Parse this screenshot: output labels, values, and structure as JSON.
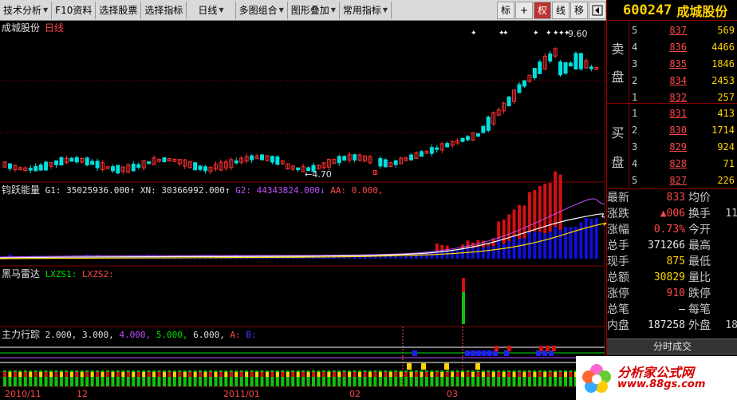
{
  "toolbar": {
    "items": [
      "技术分析",
      "F10资料",
      "选择股票",
      "选择指标",
      "日线",
      "多图组合",
      "图形叠加",
      "常用指标"
    ],
    "small_buttons": [
      "标",
      "+",
      "权",
      "线",
      "移"
    ],
    "active_small": 2
  },
  "chart": {
    "stock_name": "成城股份",
    "period": "日线",
    "high_label": "9.60",
    "low_label": "4.70",
    "x_axis_labels": [
      "2010/11",
      "12",
      "2011/01",
      "02",
      "03"
    ]
  },
  "indicators": {
    "energy": {
      "name": "钧跃能量",
      "g1": "G1: 35025936.000↑",
      "xn": "XN: 30366992.000↑",
      "g2": "G2: 44343824.000↓",
      "aa": "AA: 0.000,"
    },
    "radar": {
      "name": "黑马雷达",
      "lxzs1": "LXZS1:",
      "lxzs2": "LXZS2:"
    },
    "tracking": {
      "name": "主力行踪",
      "v1": "2.000,",
      "v2": "3.000,",
      "v3": "4.000,",
      "v4": "5.000,",
      "v5": "6.000,",
      "a": "A:",
      "b": "B:"
    }
  },
  "quote": {
    "code": "600247",
    "name": "成城股份",
    "sell_label": [
      "卖",
      "盘"
    ],
    "buy_label": [
      "买",
      "盘"
    ],
    "asks": [
      {
        "level": "5",
        "price": "837",
        "vol": "569"
      },
      {
        "level": "4",
        "price": "836",
        "vol": "4466"
      },
      {
        "level": "3",
        "price": "835",
        "vol": "1846"
      },
      {
        "level": "2",
        "price": "834",
        "vol": "2453"
      },
      {
        "level": "1",
        "price": "832",
        "vol": "257"
      }
    ],
    "bids": [
      {
        "level": "1",
        "price": "831",
        "vol": "413"
      },
      {
        "level": "2",
        "price": "830",
        "vol": "1714"
      },
      {
        "level": "3",
        "price": "829",
        "vol": "924"
      },
      {
        "level": "4",
        "price": "828",
        "vol": "71"
      },
      {
        "level": "5",
        "price": "827",
        "vol": "226"
      }
    ],
    "stats": [
      {
        "l": "最新",
        "v": "833",
        "vc": "red",
        "l2": "均价",
        "v2": ""
      },
      {
        "l": "涨跌",
        "v": "▲006",
        "vc": "red",
        "l2": "换手",
        "v2": "11"
      },
      {
        "l": "涨幅",
        "v": "0.73%",
        "vc": "red",
        "l2": "今开",
        "v2": ""
      },
      {
        "l": "总手",
        "v": "371266",
        "vc": "wht",
        "l2": "最高",
        "v2": ""
      },
      {
        "l": "现手",
        "v": "875",
        "vc": "yel",
        "l2": "最低",
        "v2": ""
      },
      {
        "l": "总额",
        "v": "30829",
        "vc": "yel",
        "l2": "量比",
        "v2": ""
      },
      {
        "l": "涨停",
        "v": "910",
        "vc": "red",
        "l2": "跌停",
        "v2": ""
      },
      {
        "l": "总笔",
        "v": "–",
        "vc": "wht",
        "l2": "每笔",
        "v2": ""
      },
      {
        "l": "内盘",
        "v": "187258",
        "vc": "wht",
        "l2": "外盘",
        "v2": "18"
      }
    ],
    "tick_button": "分时成交"
  },
  "logo": {
    "cn": "分析家公式网",
    "url": "www.88gs.com"
  },
  "colors": {
    "up": "#ff3030",
    "down": "#00e0e0",
    "grid": "#800000",
    "accent": "#ffd400"
  }
}
